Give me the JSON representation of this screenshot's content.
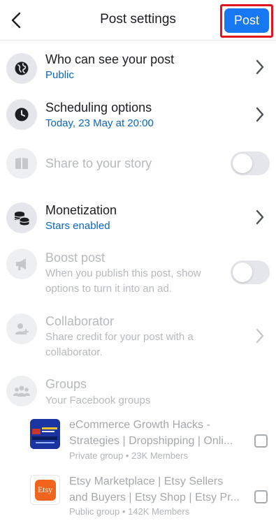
{
  "header": {
    "title": "Post settings",
    "post_label": "Post"
  },
  "settings": {
    "audience": {
      "title": "Who can see your post",
      "value": "Public"
    },
    "scheduling": {
      "title": "Scheduling options",
      "value": "Today, 23 May at 20:00"
    },
    "story": {
      "title": "Share to your story"
    },
    "monetization": {
      "title": "Monetization",
      "value": "Stars enabled"
    },
    "boost": {
      "title": "Boost post",
      "description": "When you publish this post, show options to turn it into an ad."
    },
    "collaborator": {
      "title": "Collaborator",
      "description": "Share credit for your post with a collaborator."
    },
    "groups": {
      "title": "Groups",
      "description": "Your Facebook groups"
    }
  },
  "groups": [
    {
      "name": "eCommerce Growth Hacks - Strategies | Dropshipping | Onli...",
      "meta": "Private group • 23K Members"
    },
    {
      "name": "Etsy Marketplace | Etsy Sellers and Buyers | Etsy Shop | Etsy Pr...",
      "meta": "Public group • 142K Members",
      "logo_text": "Etsy"
    }
  ],
  "colors": {
    "accent": "#1877f2",
    "link": "#0866c4",
    "highlight_border": "#e0151f",
    "etsy_orange": "#f1641e"
  }
}
